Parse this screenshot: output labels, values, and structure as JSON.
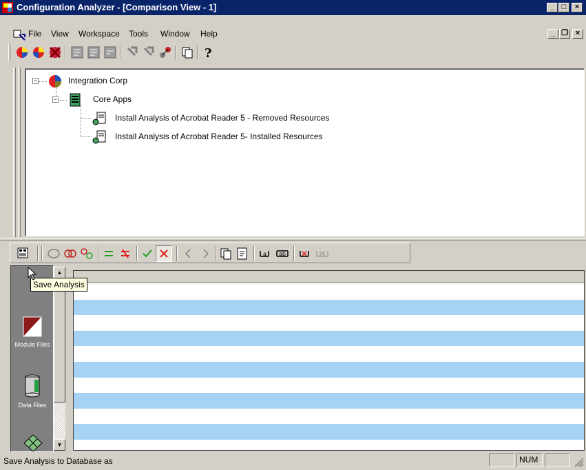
{
  "window": {
    "title": "Configuration Analyzer - [Comparison View - 1]",
    "caption_buttons": {
      "minimize": "_",
      "maximize": "□",
      "close": "×"
    },
    "mdi_buttons": {
      "minimize": "_",
      "restore": "❐",
      "close": "×"
    }
  },
  "menu": {
    "items": [
      "File",
      "View",
      "Workspace",
      "Tools",
      "Window",
      "Help"
    ]
  },
  "main_toolbar": {
    "icons": [
      "analysis-new-icon",
      "analysis-open-icon",
      "analysis-delete-icon",
      "form-icon-1",
      "form-icon-2",
      "form-icon-3",
      "pick-tool-icon-1",
      "pick-tool-icon-2",
      "network-icon",
      "copy-icon",
      "help-icon"
    ]
  },
  "tree": {
    "root": "Integration Corp",
    "group": "Core Apps",
    "items": [
      "Install Analysis of Acrobat Reader 5 - Removed Resources",
      "Install Analysis of Acrobat Reader 5- Installed Resources"
    ]
  },
  "comparison_toolbar": {
    "icons": [
      "save-analysis-icon",
      "circle-icon",
      "overlap-icon",
      "differ-icon",
      "equal-icon",
      "not-equal-icon",
      "check-icon",
      "cross-icon",
      "previous-icon",
      "next-icon",
      "copy-icon",
      "paste-icon",
      "filter-icon",
      "filter-ab-icon",
      "remove-filter-icon",
      "filter-disabled-icon"
    ]
  },
  "tooltip": {
    "text": "Save Analysis"
  },
  "left_nav": {
    "items": [
      {
        "label": "Module Files",
        "icon": "module-files-icon"
      },
      {
        "label": "Data Files",
        "icon": "data-files-icon"
      },
      {
        "label": "",
        "icon": "network-objects-icon"
      }
    ]
  },
  "grid": {
    "row_colors": [
      "#ffffff",
      "#a6d2f4"
    ]
  },
  "status": {
    "message": "Save Analysis to Database as",
    "panels": [
      "",
      "NUM",
      ""
    ]
  }
}
